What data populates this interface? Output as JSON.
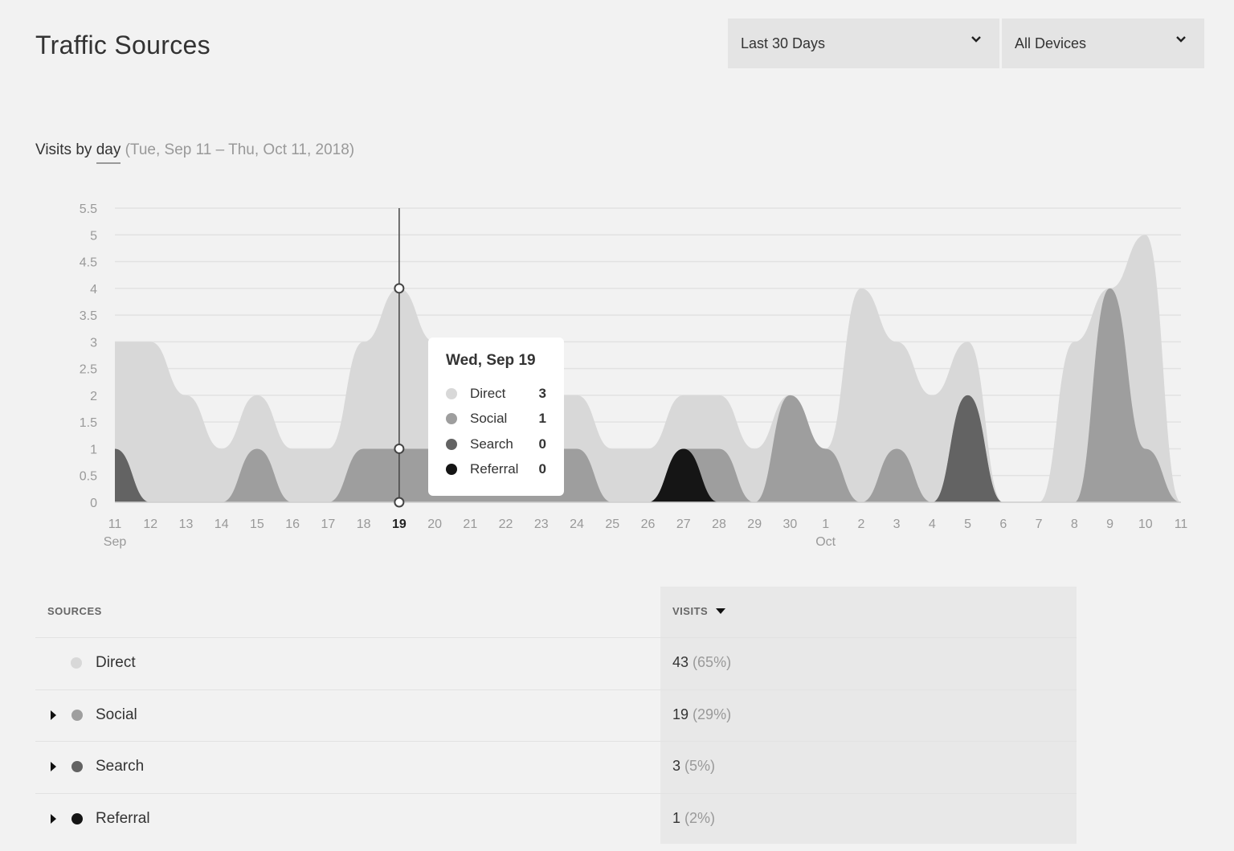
{
  "header": {
    "title": "Traffic Sources",
    "range_dropdown": "Last 30 Days",
    "device_dropdown": "All Devices"
  },
  "subtitle": {
    "prefix": "Visits by",
    "granularity": "day",
    "range": "(Tue, Sep 11 – Thu, Oct 11, 2018)"
  },
  "colors": {
    "direct": "#d8d8d8",
    "social": "#9e9e9e",
    "search": "#636363",
    "referral": "#151515"
  },
  "tooltip": {
    "title": "Wed, Sep 19",
    "rows": [
      {
        "label": "Direct",
        "value": "3",
        "key": "direct"
      },
      {
        "label": "Social",
        "value": "1",
        "key": "social"
      },
      {
        "label": "Search",
        "value": "0",
        "key": "search"
      },
      {
        "label": "Referral",
        "value": "0",
        "key": "referral"
      }
    ]
  },
  "chart_data": {
    "type": "area",
    "stacked": true,
    "title": "Visits by day (Tue, Sep 11 – Thu, Oct 11, 2018)",
    "xlabel": "",
    "ylabel": "",
    "ylim": [
      0,
      5.5
    ],
    "yticks": [
      "0",
      "0.5",
      "1",
      "1.5",
      "2",
      "2.5",
      "3",
      "3.5",
      "4",
      "4.5",
      "5",
      "5.5"
    ],
    "categories": [
      "11",
      "12",
      "13",
      "14",
      "15",
      "16",
      "17",
      "18",
      "19",
      "20",
      "21",
      "22",
      "23",
      "24",
      "25",
      "26",
      "27",
      "28",
      "29",
      "30",
      "1",
      "2",
      "3",
      "4",
      "5",
      "6",
      "7",
      "8",
      "9",
      "10",
      "11"
    ],
    "month_labels": [
      {
        "index": 0,
        "label": "Sep"
      },
      {
        "index": 20,
        "label": "Oct"
      }
    ],
    "highlighted_index": 8,
    "grid": true,
    "series": [
      {
        "name": "Referral",
        "key": "referral",
        "values": [
          0,
          0,
          0,
          0,
          0,
          0,
          0,
          0,
          0,
          0,
          0,
          0,
          0,
          0,
          0,
          0,
          1,
          0,
          0,
          0,
          0,
          0,
          0,
          0,
          0,
          0,
          0,
          0,
          0,
          0,
          0
        ]
      },
      {
        "name": "Search",
        "key": "search",
        "values": [
          1,
          0,
          0,
          0,
          0,
          0,
          0,
          0,
          0,
          0,
          0,
          0,
          0,
          0,
          0,
          0,
          0,
          0,
          0,
          0,
          0,
          0,
          0,
          0,
          2,
          0,
          0,
          0,
          0,
          0,
          0
        ]
      },
      {
        "name": "Social",
        "key": "social",
        "values": [
          0,
          0,
          0,
          0,
          1,
          0,
          0,
          1,
          1,
          1,
          1,
          1,
          1,
          1,
          0,
          0,
          0,
          1,
          0,
          2,
          1,
          0,
          1,
          0,
          0,
          0,
          0,
          0,
          4,
          1,
          0
        ]
      },
      {
        "name": "Direct",
        "key": "direct",
        "values": [
          2,
          3,
          2,
          1,
          1,
          1,
          1,
          2,
          3,
          2,
          2,
          2,
          1,
          1,
          1,
          1,
          1,
          1,
          1,
          0,
          0,
          4,
          2,
          2,
          1,
          0,
          0,
          3,
          0,
          4,
          0
        ]
      }
    ]
  },
  "table": {
    "col_sources": "SOURCES",
    "col_visits": "VISITS",
    "rows": [
      {
        "name": "Direct",
        "key": "direct",
        "expandable": false,
        "visits": "43",
        "pct": "(65%)"
      },
      {
        "name": "Social",
        "key": "social",
        "expandable": true,
        "visits": "19",
        "pct": "(29%)"
      },
      {
        "name": "Search",
        "key": "search",
        "expandable": true,
        "visits": "3",
        "pct": "(5%)"
      },
      {
        "name": "Referral",
        "key": "referral",
        "expandable": true,
        "visits": "1",
        "pct": "(2%)"
      }
    ]
  }
}
